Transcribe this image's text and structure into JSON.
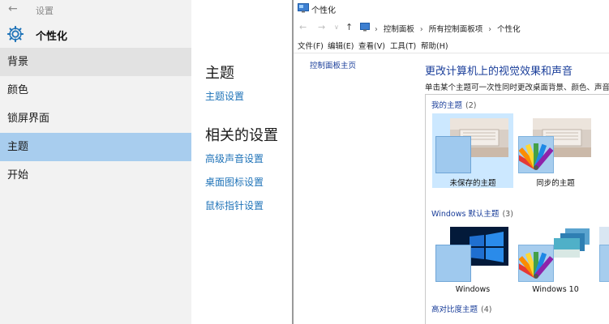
{
  "settings": {
    "app_title": "设置",
    "header_title": "个性化",
    "nav": [
      {
        "label": "背景"
      },
      {
        "label": "颜色"
      },
      {
        "label": "锁屏界面"
      },
      {
        "label": "主题"
      },
      {
        "label": "开始"
      }
    ],
    "content": {
      "heading": "主题",
      "theme_settings_link": "主题设置",
      "related_heading": "相关的设置",
      "links": [
        "高级声音设置",
        "桌面图标设置",
        "鼠标指针设置"
      ]
    }
  },
  "control_panel": {
    "window_title": "个性化",
    "breadcrumbs": [
      "控制面板",
      "所有控制面板项",
      "个性化"
    ],
    "menus": [
      "文件(F)",
      "编辑(E)",
      "查看(V)",
      "工具(T)",
      "帮助(H)"
    ],
    "left_link": "控制面板主页",
    "main_title": "更改计算机上的视觉效果和声音",
    "description": "单击某个主题可一次性同时更改桌面背景、颜色、声音和屏幕保护程序。",
    "groups": [
      {
        "title": "我的主题",
        "count": "(2)",
        "themes": [
          "未保存的主题",
          "同步的主题"
        ]
      },
      {
        "title": "Windows 默认主题",
        "count": "(3)",
        "themes": [
          "Windows",
          "Windows 10"
        ]
      },
      {
        "title": "高对比度主题",
        "count": "(4)",
        "themes": []
      }
    ]
  }
}
